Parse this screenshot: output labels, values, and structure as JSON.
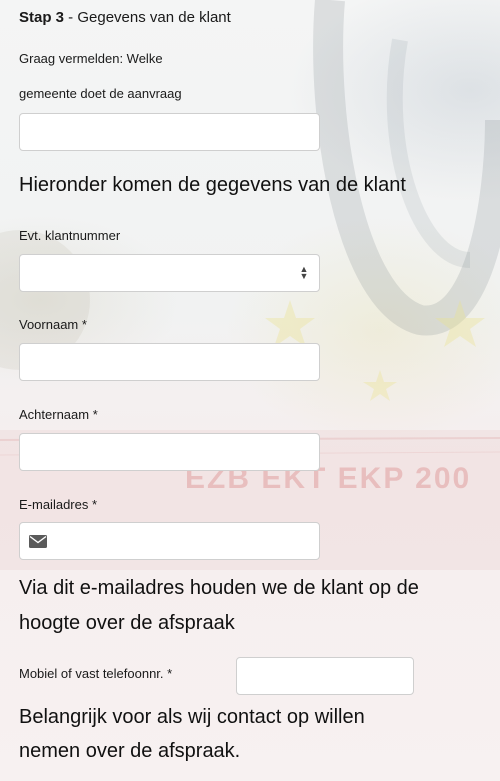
{
  "step": {
    "number_label": "Stap 3",
    "separator": " - ",
    "title": "Gegevens van de klant"
  },
  "gemeente": {
    "label_line1": "Graag vermelden: Welke",
    "label_line2": "gemeente doet de aanvraag",
    "value": ""
  },
  "section_heading": "Hieronder komen de gegevens van de klant",
  "klantnummer": {
    "label": "Evt. klantnummer",
    "value": ""
  },
  "voornaam": {
    "label": "Voornaam *",
    "value": ""
  },
  "achternaam": {
    "label": "Achternaam *",
    "value": ""
  },
  "email": {
    "label": "E-mailadres *",
    "value": "",
    "icon": "envelope-icon"
  },
  "email_note": {
    "line1": "Via dit e-mailadres houden we de klant op de",
    "line2": "hoogte over de afspraak"
  },
  "telefoon": {
    "label": "Mobiel of vast telefoonnr. *",
    "value": ""
  },
  "telefoon_note": {
    "line1": "Belangrijk voor als wij contact op willen",
    "line2": "nemen over de afspraak."
  },
  "banknote_text": "EZB EKT EKP 200",
  "colors": {
    "input_background": "#ffffff",
    "input_border": "#cfcfcf",
    "text": "#1a1a1a"
  }
}
